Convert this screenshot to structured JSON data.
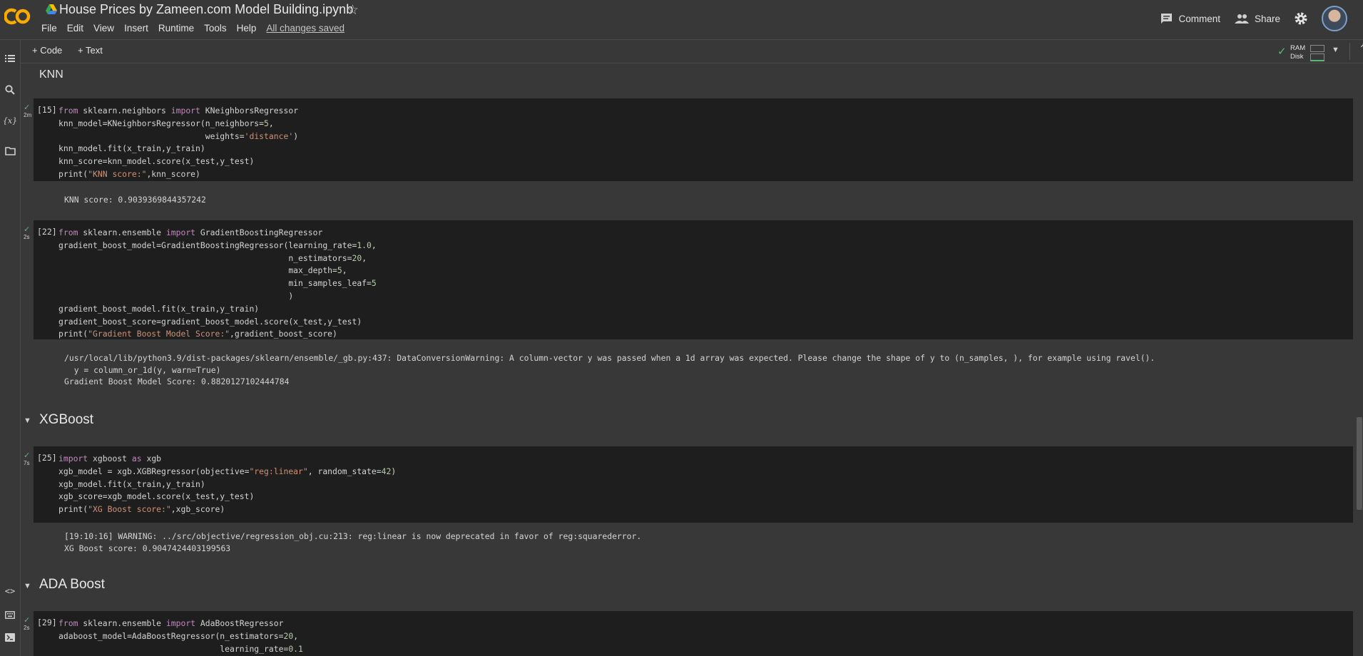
{
  "app": {
    "logo_text": "CO",
    "title": "House Prices by Zameen.com Model Building.ipynb",
    "menu": [
      "File",
      "Edit",
      "View",
      "Insert",
      "Runtime",
      "Tools",
      "Help"
    ],
    "save_status": "All changes saved",
    "comment_label": "Comment",
    "share_label": "Share"
  },
  "toolbar": {
    "code_label": "+ Code",
    "text_label": "+ Text",
    "ram_label": "RAM",
    "disk_label": "Disk"
  },
  "colors": {
    "accent_orange": "#f9ab00",
    "keyword": "#c586c0",
    "string": "#ce9178",
    "number": "#b5cea8",
    "check_green": "#5bb974"
  },
  "cells": {
    "knn_heading": "KNN",
    "knn": {
      "prompt": "[15]",
      "time": "2m",
      "output": "KNN score: 0.9039369844357242"
    },
    "gb": {
      "prompt": "[22]",
      "time": "2s",
      "output": "/usr/local/lib/python3.9/dist-packages/sklearn/ensemble/_gb.py:437: DataConversionWarning: A column-vector y was passed when a 1d array was expected. Please change the shape of y to (n_samples, ), for example using ravel().\n  y = column_or_1d(y, warn=True)\nGradient Boost Model Score: 0.8820127102444784"
    },
    "xgboost_heading": "XGBoost",
    "xgb": {
      "prompt": "[25]",
      "time": "7s",
      "output": "[19:10:16] WARNING: ../src/objective/regression_obj.cu:213: reg:linear is now deprecated in favor of reg:squarederror.\nXG Boost score: 0.9047424403199563"
    },
    "ada_heading": "ADA Boost",
    "ada": {
      "prompt": "[29]",
      "time": "2s"
    }
  }
}
